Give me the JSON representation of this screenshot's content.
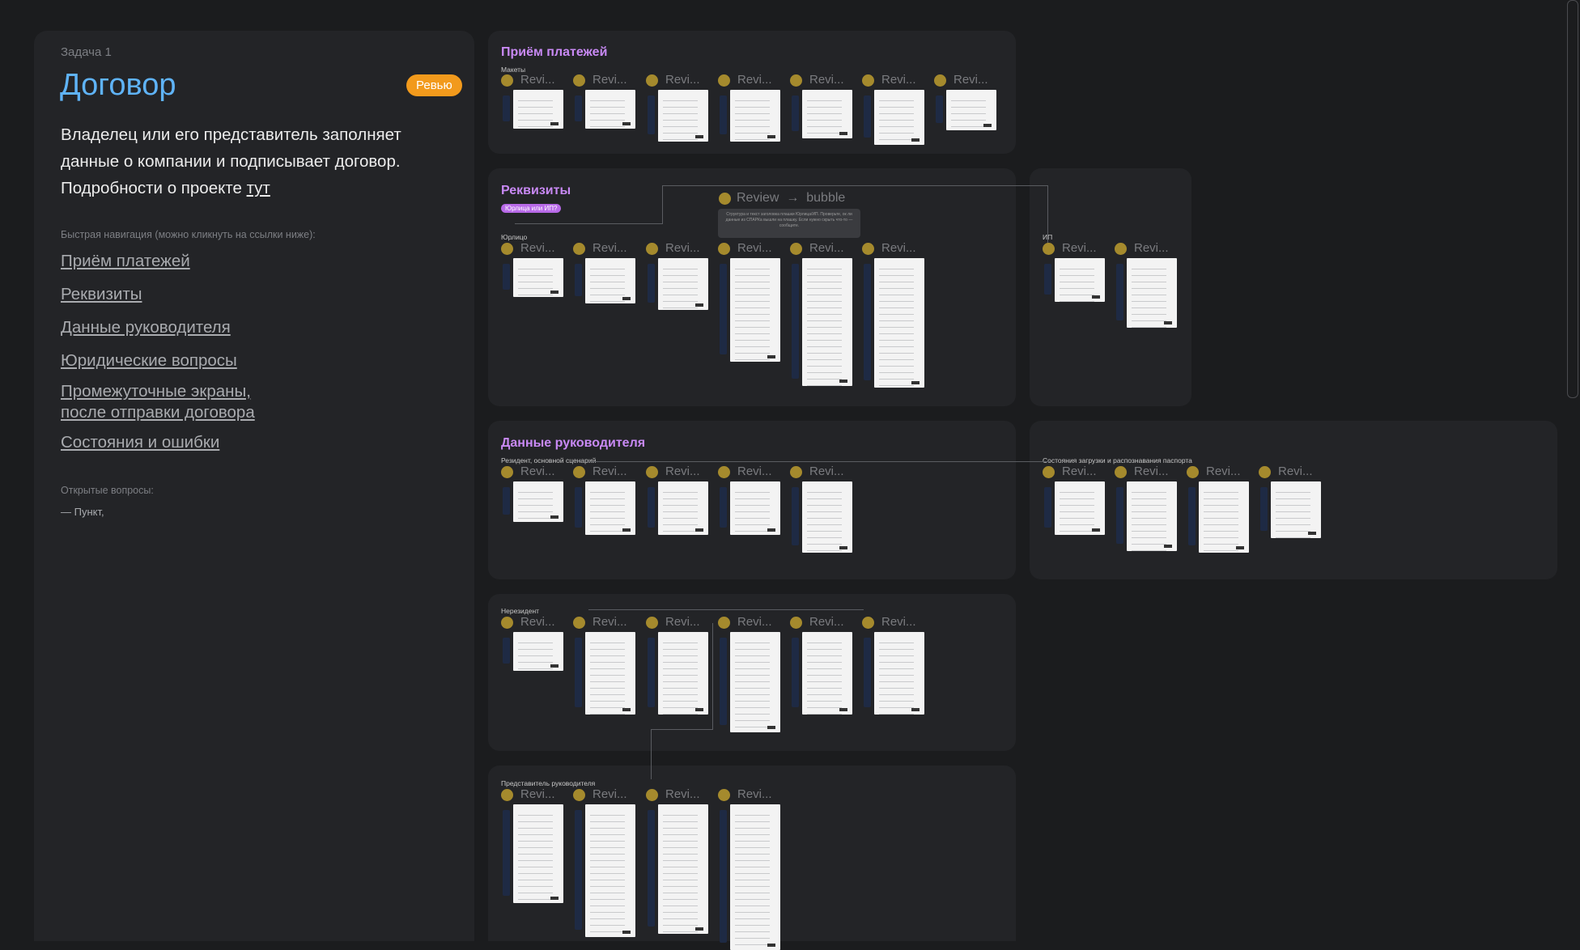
{
  "brief": {
    "task_label": "Задача 1",
    "title": "Договор",
    "badge": "Ревью",
    "description_line1": "Владелец или его представитель заполняет",
    "description_line2": "данные о компании и подписывает договор.",
    "description_line3": "Подробности о проекте ",
    "description_link": "тут",
    "nav_label": "Быстрая навигация (можно кликнуть на ссылки ниже):",
    "nav_links": [
      "Приём платежей",
      "Реквизиты",
      "Данные руководителя",
      "Юридические вопросы",
      "Промежуточные экраны,",
      "после отправки договора",
      "Состояния и ошибки"
    ],
    "open_questions_label": "Открытые вопросы:",
    "open_questions_item": "— Пункт,"
  },
  "canvas": {
    "review_label": "Revi...",
    "sections": {
      "payments": {
        "title": "Приём платежей",
        "sub": "Макеты"
      },
      "requisites": {
        "title": "Реквизиты",
        "tag": "Юрлица или ИП?",
        "sub_legal": "Юрлицо",
        "sub_ip": "ИП"
      },
      "director": {
        "title": "Данные руководителя",
        "sub_resident": "Резидент, основной сценарий",
        "sub_passport": "Состояния загрузки и распознавания паспорта"
      },
      "nonresident": {
        "sub": "Нерезидент"
      },
      "representative": {
        "sub": "Представитель руководителя"
      }
    },
    "bubble": {
      "label": "Review",
      "arrow": "→",
      "target": "bubble",
      "tooltip": "Структура и текст заголовка плашки Юрлица/ИП. Проверьте, ок ли данные из СПАРКа вышли на плашку. Если нужно скрыть что-то — сообщите."
    }
  },
  "colors": {
    "background": "#1b1c1e",
    "panel": "#232427",
    "title_blue": "#5fb3f7",
    "badge_orange": "#f29a1c",
    "section_purple": "#c889f4",
    "review_dot": "#a58a2d"
  }
}
